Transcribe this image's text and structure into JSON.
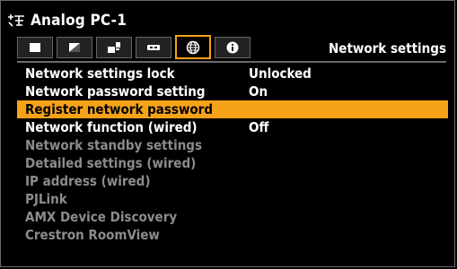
{
  "header": {
    "source": "Analog PC-1",
    "source_icon": "analog-pc-icon"
  },
  "tabs": [
    {
      "icon": "image-screen-icon",
      "active": false
    },
    {
      "icon": "image-adjust-icon",
      "active": false
    },
    {
      "icon": "install-settings-icon",
      "active": false
    },
    {
      "icon": "system-settings-icon",
      "active": false
    },
    {
      "icon": "network-globe-icon",
      "active": true
    },
    {
      "icon": "info-icon",
      "active": false
    }
  ],
  "section_title": "Network settings",
  "colors": {
    "accent": "#f5a21a",
    "dim_text": "#8c8c8c"
  },
  "menu": [
    {
      "label": "Network settings lock",
      "value": "Unlocked"
    },
    {
      "label": "Network password setting",
      "value": "On"
    },
    {
      "label": "Register network password",
      "value": ""
    },
    {
      "label": "Network function (wired)",
      "value": "Off"
    },
    {
      "label": "Network standby settings",
      "value": ""
    },
    {
      "label": "Detailed settings (wired)",
      "value": ""
    },
    {
      "label": "IP address (wired)",
      "value": ""
    },
    {
      "label": "PJLink",
      "value": ""
    },
    {
      "label": "AMX Device Discovery",
      "value": ""
    },
    {
      "label": "Crestron RoomView",
      "value": ""
    }
  ]
}
